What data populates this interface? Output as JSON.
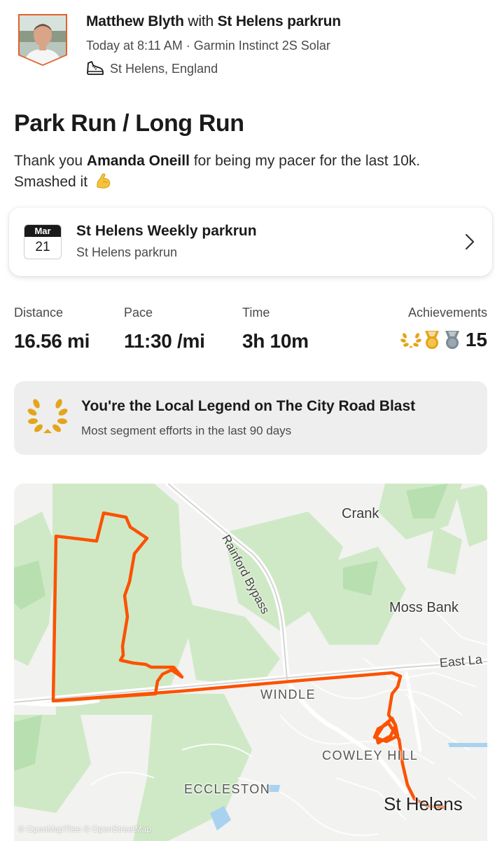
{
  "activity": {
    "athlete_name": "Matthew Blyth",
    "with_text": "with",
    "club": "St Helens parkrun",
    "meta": "Today at 8:11 AM · Garmin Instinct 2S Solar",
    "location": "St Helens, England",
    "title": "Park Run / Long Run",
    "description": {
      "part1": "Thank you",
      "name": "Amanda Oneill",
      "part2": "for being my pacer for the last 10k.",
      "part3": "Smashed it"
    }
  },
  "event": {
    "month": "Mar",
    "day": "21",
    "title": "St Helens Weekly parkrun",
    "subtitle": "St Helens parkrun"
  },
  "stats": [
    {
      "label": "Distance",
      "value": "16.56 mi"
    },
    {
      "label": "Pace",
      "value": "11:30 /mi"
    },
    {
      "label": "Time",
      "value": "3h 10m"
    }
  ],
  "achievements": {
    "label": "Achievements",
    "count": "15"
  },
  "legend": {
    "title": "You're the Local Legend on The City Road Blast",
    "subtitle": "Most segment efforts in the last 90 days"
  },
  "map": {
    "labels": {
      "crank": "Crank",
      "rainford_bypass": "Rainford Bypass",
      "moss_bank": "Moss Bank",
      "east_la": "East La",
      "windle": "WINDLE",
      "cowley_hill": "COWLEY HILL",
      "eccleston": "ECCLESTON",
      "st_helens": "St Helens"
    },
    "attribution": "© OpenMapTiles © OpenStreetMap"
  },
  "colors": {
    "route": "#fc5200",
    "accent": "#fc5200",
    "gold": "#e3a51b"
  }
}
